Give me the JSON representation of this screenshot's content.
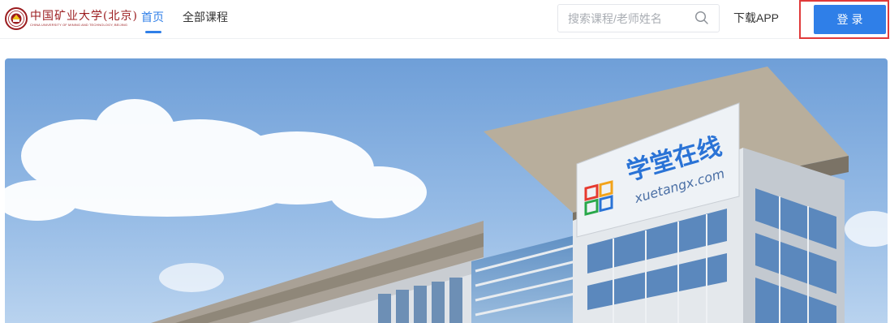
{
  "logo": {
    "name_cn": "中国矿业大学(北京)",
    "name_en": "CHINA UNIVERSITY OF MINING AND TECHNOLOGY, BEIJING",
    "emblem": "university-seal"
  },
  "nav": {
    "home": "首页",
    "all_courses": "全部课程",
    "active": "home"
  },
  "search": {
    "placeholder": "搜索课程/老师姓名",
    "icon": "search-icon"
  },
  "header": {
    "download_app": "下载APP",
    "login": "登录"
  },
  "banner": {
    "sign_cn": "学堂在线",
    "sign_en": "xuetangx.com"
  },
  "colors": {
    "accent": "#2f7fe8",
    "logo_red": "#9b1c1f",
    "highlight": "#e03a3a"
  }
}
